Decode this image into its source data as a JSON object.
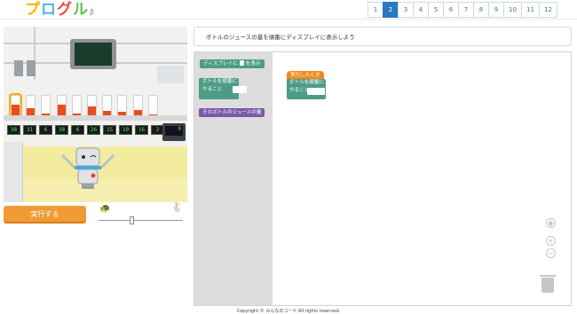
{
  "header": {
    "logo_text": [
      "プ",
      "ロ",
      "グ",
      "ル"
    ],
    "logo_beta": "β",
    "pages": [
      "1",
      "2",
      "3",
      "4",
      "5",
      "6",
      "7",
      "8",
      "9",
      "10",
      "11",
      "12"
    ],
    "active_page": "2"
  },
  "stage": {
    "display_values": [
      "38",
      "31",
      "6",
      "38",
      "6",
      "26",
      "15",
      "10",
      "16",
      "2"
    ],
    "panel_value": "0",
    "bottle_levels": [
      0.55,
      0.35,
      0.1,
      0.55,
      0.1,
      0.45,
      0.25,
      0.18,
      0.27,
      0.05
    ],
    "selected_bottle": 0
  },
  "controls": {
    "run_label": "実行する",
    "slow_icon": "turtle-icon",
    "fast_icon": "rabbit-icon",
    "speed_fraction": 0.38
  },
  "task": {
    "text": "ボトルのジュースの量を順番にディスプレイに表示しよう"
  },
  "toolbox": {
    "display_block_prefix": "ディスプレイに",
    "display_block_suffix": "を表示",
    "loop_block_line1": "ボトルを順番に",
    "loop_block_line2": "やること",
    "variable_block": "そのボトルのジュースの量"
  },
  "workspace": {
    "event_block": "実行したとき",
    "loop_block_line1": "ボトルを順番に",
    "loop_block_line2": "やること"
  },
  "footer": {
    "copyright": "Copyright © みんなのコード All rights reserved."
  },
  "colors": {
    "accent": "#2a7abf",
    "run_button": "#f09a33",
    "block_teal": "#4d9c86",
    "block_purple": "#7b5aa6",
    "block_orange": "#ef8a1c",
    "juice": "#ea4d1c"
  }
}
